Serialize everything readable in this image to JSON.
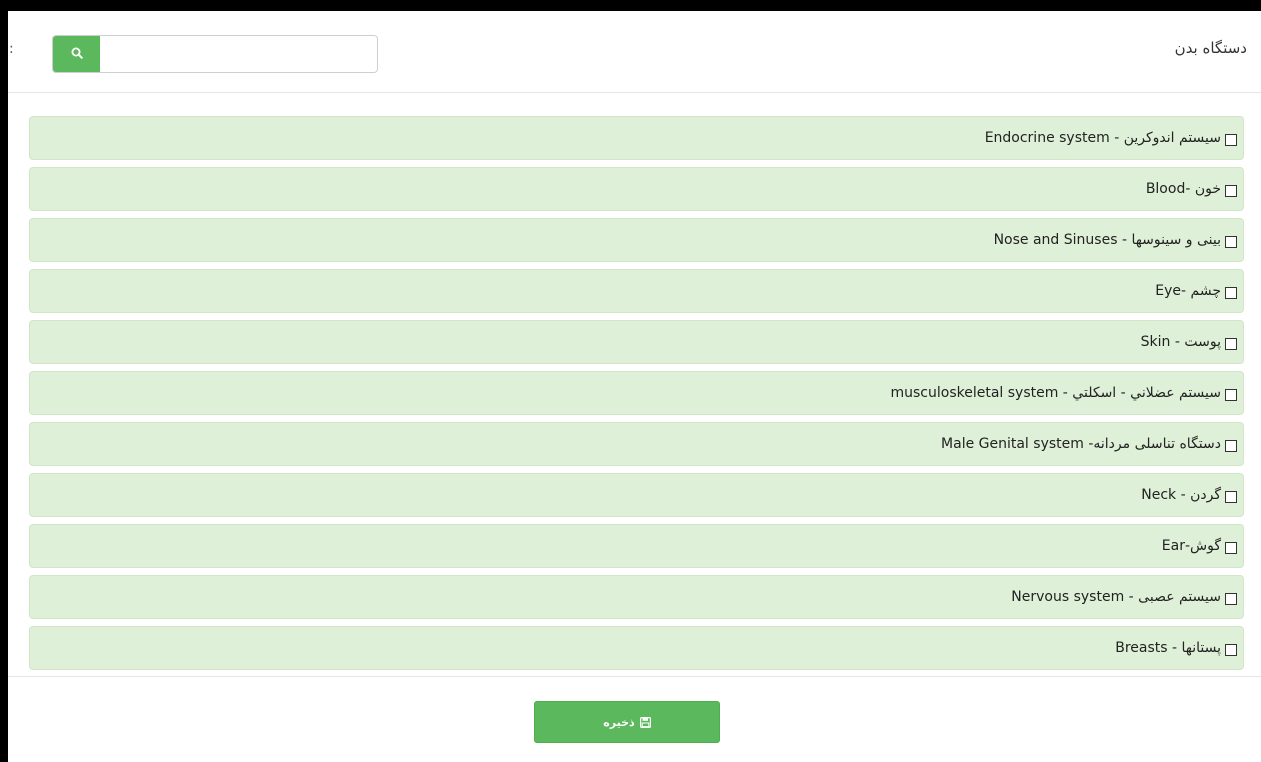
{
  "header": {
    "title": "دستگاه بدن",
    "left_mark": ":"
  },
  "search": {
    "value": "",
    "placeholder": "",
    "icon": "search-icon"
  },
  "items": [
    {
      "label": "سیستم اندوکرین - Endocrine system",
      "checked": false
    },
    {
      "label": "خون -Blood",
      "checked": false
    },
    {
      "label": "بینی و سینوسها - Nose and Sinuses",
      "checked": false
    },
    {
      "label": "چشم -Eye",
      "checked": false
    },
    {
      "label": "پوست - Skin",
      "checked": false
    },
    {
      "label": "سیستم عضلاني - اسكلتي - musculoskeletal system",
      "checked": false
    },
    {
      "label": "دستگاه تناسلی مردانه- Male Genital system",
      "checked": false
    },
    {
      "label": "گردن - Neck",
      "checked": false
    },
    {
      "label": "گوش-Ear",
      "checked": false
    },
    {
      "label": "سیستم عصبی - Nervous system",
      "checked": false
    },
    {
      "label": "پستانها - Breasts",
      "checked": false
    }
  ],
  "footer": {
    "save_label": "ذخیره",
    "save_icon": "floppy-disk-icon"
  },
  "colors": {
    "accent": "#5cb85c",
    "item_background": "#dff0d8"
  }
}
